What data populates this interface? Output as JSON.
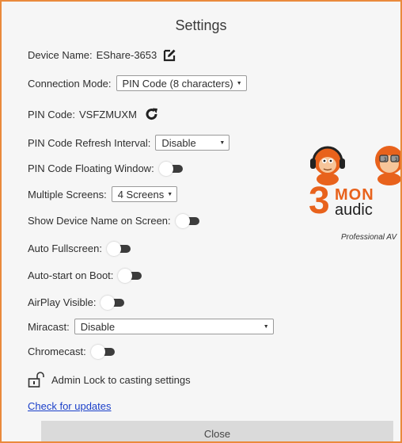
{
  "dialog": {
    "title": "Settings"
  },
  "device_name": {
    "label": "Device Name:",
    "value": "EShare-3653",
    "edit_icon": "edit-icon"
  },
  "connection_mode": {
    "label": "Connection Mode:",
    "selected": "PIN Code (8 characters)"
  },
  "pin_code": {
    "label": "PIN Code:",
    "value": "VSFZMUXM",
    "refresh_icon": "refresh-icon"
  },
  "pin_refresh_interval": {
    "label": "PIN Code Refresh Interval:",
    "selected": "Disable"
  },
  "pin_floating_window": {
    "label": "PIN Code Floating Window:",
    "on": false
  },
  "multiple_screens": {
    "label": "Multiple Screens:",
    "selected": "4 Screens"
  },
  "show_device_name": {
    "label": "Show Device Name on Screen:",
    "on": false
  },
  "auto_fullscreen": {
    "label": "Auto Fullscreen:",
    "on": false
  },
  "auto_start": {
    "label": "Auto-start on Boot:",
    "on": false
  },
  "airplay_visible": {
    "label": "AirPlay Visible:",
    "on": false
  },
  "miracast": {
    "label": "Miracast:",
    "selected": "Disable"
  },
  "chromecast": {
    "label": "Chromecast:",
    "on": false
  },
  "admin_lock": {
    "label": "Admin Lock to casting settings",
    "icon": "unlock-icon"
  },
  "check_updates": {
    "label": "Check for updates"
  },
  "close_button": {
    "label": "Close"
  },
  "logo": {
    "number": "3",
    "brand_top": "MON",
    "brand_bottom": "audic",
    "tagline": "Professional AV"
  },
  "colors": {
    "border": "#ea8a3c",
    "link": "#1a3fc9",
    "logo_orange": "#e8621c",
    "toggle_track": "#3c3c3c"
  }
}
